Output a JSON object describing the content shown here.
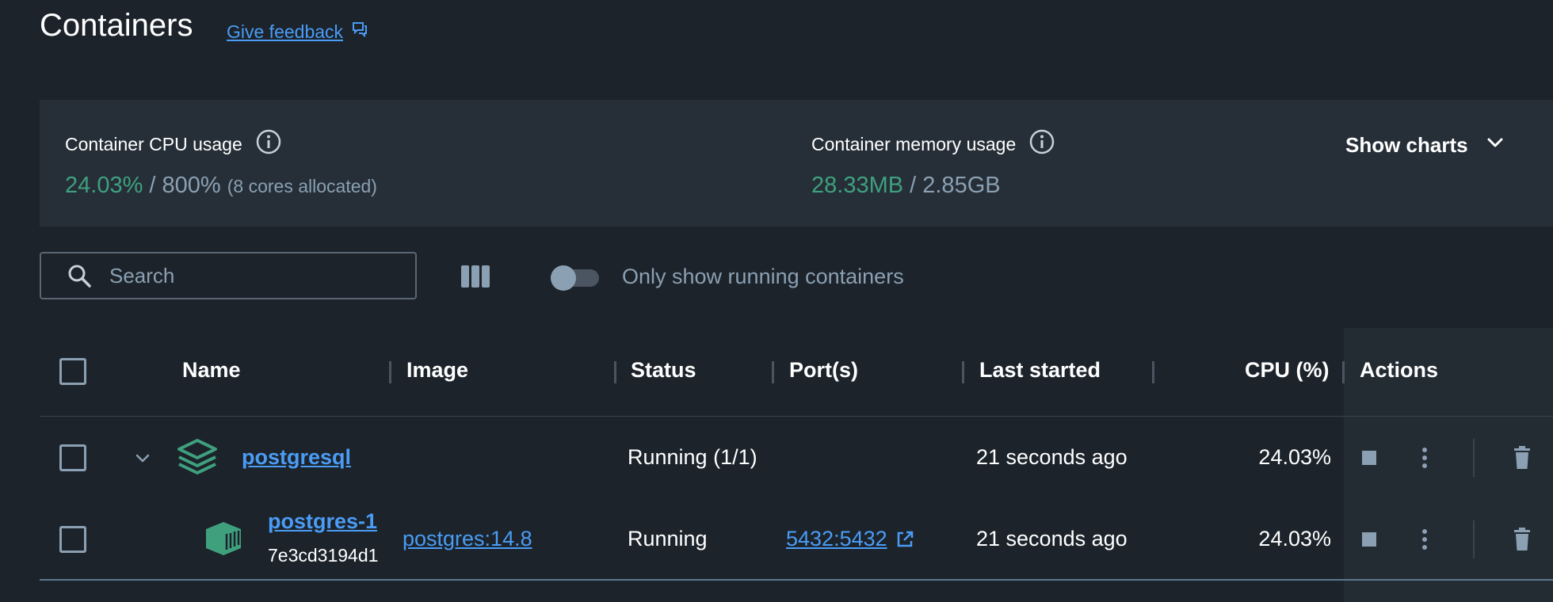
{
  "header": {
    "title": "Containers",
    "feedback_label": "Give feedback"
  },
  "stats": {
    "cpu": {
      "label": "Container CPU usage",
      "used": "24.03%",
      "separator": " / ",
      "total": "800%",
      "note": "(8 cores allocated)"
    },
    "memory": {
      "label": "Container memory usage",
      "used": "28.33MB",
      "separator": " / ",
      "total": "2.85GB"
    },
    "show_charts_label": "Show charts"
  },
  "toolbar": {
    "search_placeholder": "Search",
    "only_running_label": "Only show running containers",
    "only_running_enabled": false
  },
  "table": {
    "columns": {
      "name": "Name",
      "image": "Image",
      "status": "Status",
      "ports": "Port(s)",
      "last_started": "Last started",
      "cpu": "CPU (%)",
      "actions": "Actions"
    },
    "rows": [
      {
        "name": "postgresql",
        "image": "",
        "status": "Running (1/1)",
        "ports": "",
        "last_started": "21 seconds ago",
        "cpu": "24.03%"
      },
      {
        "name": "postgres-1",
        "id": "7e3cd3194d1",
        "image": "postgres:14.8",
        "status": "Running",
        "ports": "5432:5432",
        "last_started": "21 seconds ago",
        "cpu": "24.03%"
      }
    ]
  },
  "colors": {
    "background": "#1c232b",
    "panel": "#262f38",
    "accent_link": "#4a9cf5",
    "usage_green": "#3fa07e",
    "muted": "#8ba0b2"
  },
  "icons": {
    "feedback": "feedback-icon",
    "info": "info-icon",
    "chevron": "chevron-down-icon",
    "search": "search-icon",
    "columns": "columns-icon",
    "stack": "stack-icon",
    "container": "container-icon",
    "stop": "stop-icon",
    "more": "more-vertical-icon",
    "trash": "trash-icon",
    "external": "external-link-icon"
  }
}
